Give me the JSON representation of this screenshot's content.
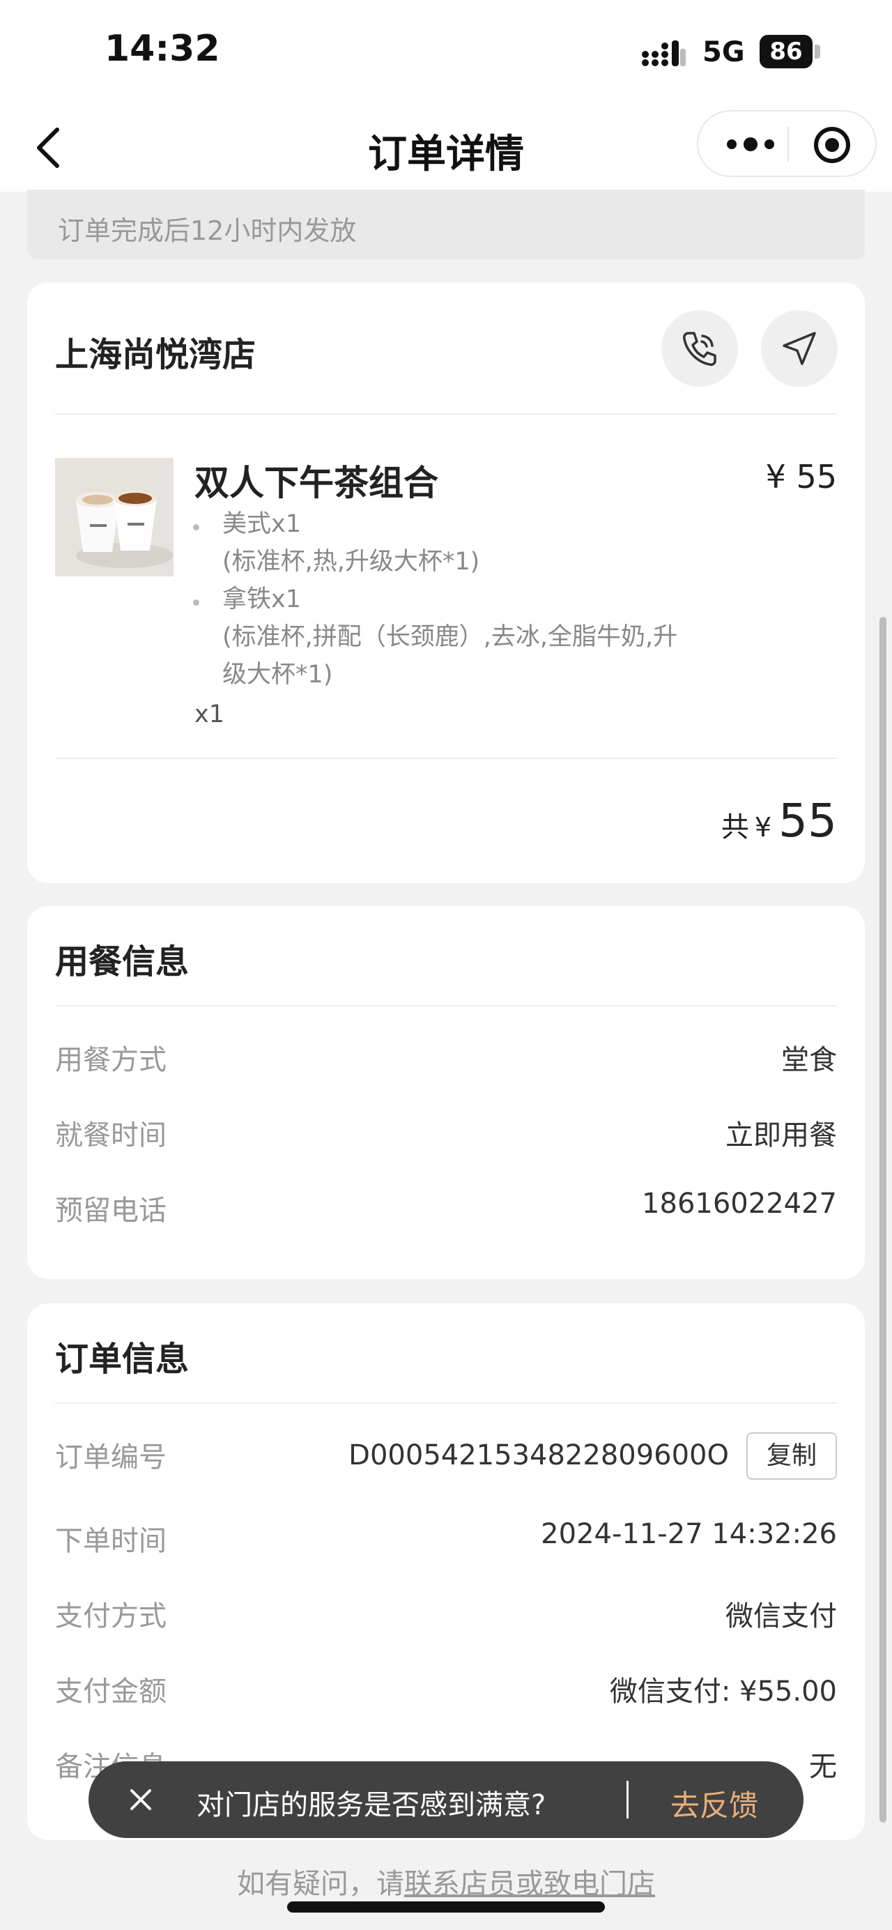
{
  "status_bar": {
    "time": "14:32",
    "network": "5G",
    "battery": "86"
  },
  "nav": {
    "title": "订单详情"
  },
  "notice": {
    "text": "订单完成后12小时内发放"
  },
  "store": {
    "name": "上海尚悦湾店",
    "item": {
      "name": "双人下午茶组合",
      "price": "¥ 55",
      "specs": [
        {
          "name": "美式x1",
          "detail": "(标准杯,热,升级大杯*1)"
        },
        {
          "name": "拿铁x1",
          "detail_line1": "(标准杯,拼配（长颈鹿）,去冰,全脂牛奶,升",
          "detail_line2": "级大杯*1)"
        }
      ],
      "quantity": "x1"
    },
    "total": {
      "prefix": "共",
      "currency": "¥",
      "amount": "55"
    }
  },
  "dining": {
    "title": "用餐信息",
    "rows": [
      {
        "label": "用餐方式",
        "value": "堂食"
      },
      {
        "label": "就餐时间",
        "value": "立即用餐"
      },
      {
        "label": "预留电话",
        "value": "18616022427"
      }
    ]
  },
  "order": {
    "title": "订单信息",
    "rows": [
      {
        "label": "订单编号",
        "value": "D0005421534822809600O"
      },
      {
        "label": "下单时间",
        "value": "2024-11-27 14:32:26"
      },
      {
        "label": "支付方式",
        "value": "微信支付"
      },
      {
        "label": "支付金额",
        "value": "微信支付: ¥55.00"
      },
      {
        "label": "备注信息",
        "value": "无"
      }
    ],
    "copy_label": "复制"
  },
  "toast": {
    "text": "对门店的服务是否感到满意?",
    "action": "去反馈"
  },
  "footer": {
    "prefix": "如有疑问，请",
    "link": "联系店员或致电门店"
  }
}
